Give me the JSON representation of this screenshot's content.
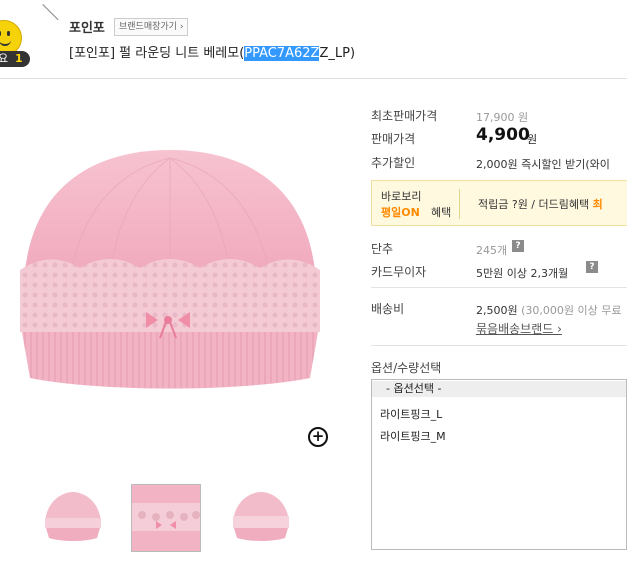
{
  "badge": {
    "label": "요",
    "rank": "1"
  },
  "header": {
    "brand": "포인포",
    "brand_shop_link": "브랜드매장가기 ›",
    "title_before": "[포인포] 펄 라운딩 니트 베레모(",
    "title_highlight": "PPAC7A62Z",
    "title_after": "Z_LP)"
  },
  "info": {
    "first_price_label": "최초판매가격",
    "first_price_value": "17,900 원",
    "price_label": "판매가격",
    "price_value": "4,900",
    "price_unit": "원",
    "extra_discount_label": "추가할인",
    "extra_discount_value": "2,000원 즉시할인 받기(와이",
    "promo": {
      "line1": "바로보리",
      "line2_orange": "평일ON",
      "line2_rest": "혜택",
      "benefit_text": "적립금 ?원 / 더드림혜택",
      "benefit_orange": "최"
    },
    "unit_label": "단추",
    "unit_value": "245개",
    "card_label": "카드무이자",
    "card_value": "5만원 이상 2,3개월",
    "shipping_label": "배송비",
    "shipping_value": "2,500원",
    "shipping_note": "(30,000원 이상 무료",
    "bundle_link": "묶음배송브랜드 ›",
    "help_icon": "?"
  },
  "options": {
    "label": "옵션/수량선택",
    "placeholder": "- 옵션선택 -",
    "items": [
      "라이트핑크_L",
      "라이트핑크_M"
    ]
  },
  "icons": {
    "zoom": "+"
  },
  "colors": {
    "highlight": "#3399ff",
    "accent": "#ff8a00",
    "hat_pink": "#f2b2c4"
  }
}
